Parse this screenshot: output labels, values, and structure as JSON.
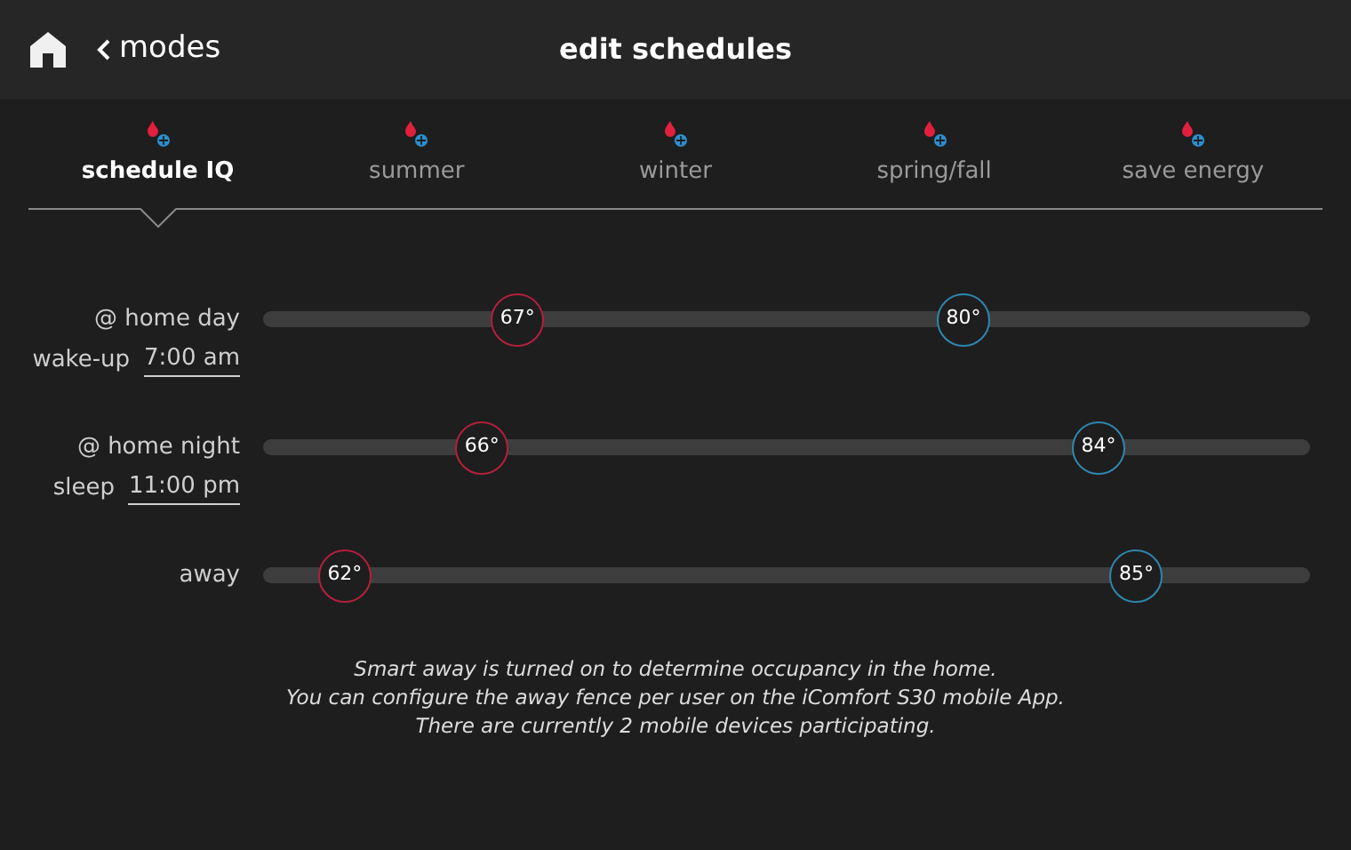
{
  "header": {
    "back": "modes",
    "title": "edit schedules"
  },
  "tabs": [
    {
      "label": "schedule IQ",
      "selected": true
    },
    {
      "label": "summer",
      "selected": false
    },
    {
      "label": "winter",
      "selected": false
    },
    {
      "label": "spring/fall",
      "selected": false
    },
    {
      "label": "save energy",
      "selected": false
    }
  ],
  "schedules": [
    {
      "name": "@ home day",
      "time_label": "wake-up",
      "time": "7:00 am",
      "thumbs": [
        {
          "kind": "heat",
          "value": "67°",
          "level": 0.243
        },
        {
          "kind": "cool",
          "value": "80°",
          "level": 0.669
        }
      ]
    },
    {
      "name": "@ home night",
      "time_label": "sleep",
      "time": "11:00 pm",
      "thumbs": [
        {
          "kind": "heat",
          "value": "66°",
          "level": 0.209
        },
        {
          "kind": "cool",
          "value": "84°",
          "level": 0.798
        }
      ]
    },
    {
      "name": "away",
      "thumbs": [
        {
          "kind": "heat",
          "value": "62°",
          "level": 0.078
        },
        {
          "kind": "cool",
          "value": "85°",
          "level": 0.834
        }
      ]
    }
  ],
  "message": [
    "Smart away is turned on to determine occupancy in the home.",
    "You can configure the away fence per user on the iComfort S30 mobile App.",
    "There are currently 2 mobile devices participating."
  ]
}
